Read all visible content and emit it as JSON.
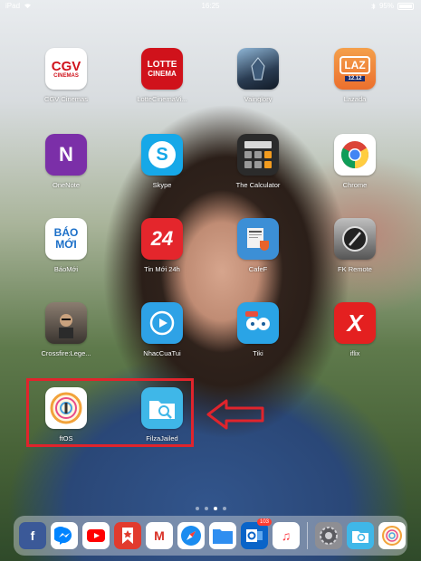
{
  "status_bar": {
    "device": "iPad",
    "time": "16:25",
    "battery": "95%"
  },
  "apps": [
    {
      "label": "CGV Cinemas",
      "icon": "cgv-icon",
      "text": "CGV",
      "subtext": "CINEMAS",
      "color": "#ffffff"
    },
    {
      "label": "LotteCinemaVi...",
      "icon": "lotte-cinema-icon",
      "text": "LOTTE",
      "subtext": "CINEMA",
      "color": "#d0121b"
    },
    {
      "label": "Vainglory",
      "icon": "vainglory-icon",
      "text": "",
      "subtext": "",
      "color": "#2a3c52"
    },
    {
      "label": "Lazada",
      "icon": "lazada-icon",
      "text": "LAZ",
      "subtext": "12.12",
      "color": "#f08a3c"
    },
    {
      "label": "OneNote",
      "icon": "onenote-icon",
      "text": "N",
      "subtext": "",
      "color": "#7b2fa8"
    },
    {
      "label": "Skype",
      "icon": "skype-icon",
      "text": "S",
      "subtext": "",
      "color": "#16a8e8"
    },
    {
      "label": "The Calculator",
      "icon": "calculator-icon",
      "text": "",
      "subtext": "",
      "color": "#2b2b2b"
    },
    {
      "label": "Chrome",
      "icon": "chrome-icon",
      "text": "",
      "subtext": "",
      "color": "#ffffff"
    },
    {
      "label": "BáoMới",
      "icon": "baomoi-icon",
      "text": "BÁO",
      "subtext": "MỚI",
      "color": "#ffffff"
    },
    {
      "label": "Tin Mới 24h",
      "icon": "tin-moi-24h-icon",
      "text": "24",
      "subtext": "",
      "color": "#e4262c"
    },
    {
      "label": "CafeF",
      "icon": "cafef-icon",
      "text": "",
      "subtext": "",
      "color": "#3c8fd6"
    },
    {
      "label": "FK Remote",
      "icon": "fk-remote-icon",
      "text": "",
      "subtext": "",
      "color": "#5a5a5a"
    },
    {
      "label": "Crossfire:Lege...",
      "icon": "crossfire-icon",
      "text": "",
      "subtext": "",
      "color": "#4a4a4a"
    },
    {
      "label": "NhacCuaTui",
      "icon": "nhaccuatui-icon",
      "text": "",
      "subtext": "",
      "color": "#2ea2e6"
    },
    {
      "label": "Tiki",
      "icon": "tiki-icon",
      "text": "",
      "subtext": "",
      "color": "#2aa4e6"
    },
    {
      "label": "iflix",
      "icon": "iflix-icon",
      "text": "X",
      "subtext": "",
      "color": "#e42020"
    },
    {
      "label": "ftOS",
      "icon": "ftos-icon",
      "text": "",
      "subtext": "",
      "color": "#ffffff"
    },
    {
      "label": "FilzaJailed",
      "icon": "filza-icon",
      "text": "",
      "subtext": "",
      "color": "#3fb7e8"
    }
  ],
  "dock": {
    "apps": [
      {
        "name": "facebook-icon",
        "text": "f",
        "color": "#3b5998"
      },
      {
        "name": "messenger-icon",
        "text": "",
        "color": "#ffffff"
      },
      {
        "name": "youtube-icon",
        "text": "",
        "color": "#ffffff"
      },
      {
        "name": "bookmark-app-icon",
        "text": "",
        "color": "#e23b2e"
      },
      {
        "name": "gmail-icon",
        "text": "M",
        "color": "#ffffff"
      },
      {
        "name": "safari-icon",
        "text": "",
        "color": "#1a8cf0"
      },
      {
        "name": "files-icon",
        "text": "",
        "color": "#2f8ef0"
      },
      {
        "name": "outlook-icon",
        "text": "",
        "color": "#0a64c8",
        "badge": "103"
      },
      {
        "name": "music-icon",
        "text": "♫",
        "color": "#ffffff"
      },
      {
        "name": "settings-icon",
        "text": "",
        "color": "#8e8e93"
      },
      {
        "name": "filza-dock-icon",
        "text": "",
        "color": "#3fb7e8"
      },
      {
        "name": "ftos-dock-icon",
        "text": "",
        "color": "#ffffff"
      }
    ]
  }
}
